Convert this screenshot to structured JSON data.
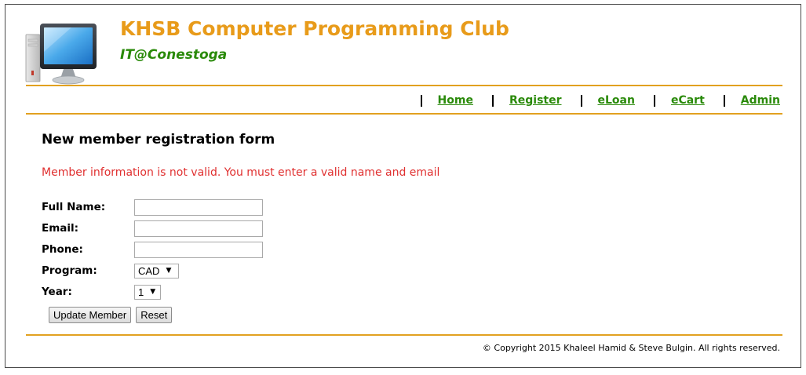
{
  "header": {
    "title": "KHSB Computer Programming Club",
    "subtitle": "IT@Conestoga",
    "logo_icon": "computer-monitor-icon",
    "title_color": "#e89b1a",
    "subtitle_color": "#2a8a0a"
  },
  "nav": {
    "items": [
      {
        "label": "Home"
      },
      {
        "label": "Register"
      },
      {
        "label": "eLoan"
      },
      {
        "label": "eCart"
      },
      {
        "label": "Admin"
      }
    ],
    "link_color": "#2a8a0a"
  },
  "main": {
    "heading": "New member registration form",
    "error": "Member information is not valid. You must enter a valid name and email",
    "error_color": "#e03030",
    "form": {
      "fullname_label": "Full Name:",
      "fullname_value": "",
      "email_label": "Email:",
      "email_value": "",
      "phone_label": "Phone:",
      "phone_value": "",
      "program_label": "Program:",
      "program_selected": "CAD",
      "year_label": "Year:",
      "year_selected": "1",
      "update_button": "Update Member",
      "reset_button": "Reset"
    }
  },
  "footer": {
    "copyright": "© Copyright 2015 Khaleel Hamid & Steve Bulgin. All rights reserved."
  },
  "accent_color": "#e2a120"
}
